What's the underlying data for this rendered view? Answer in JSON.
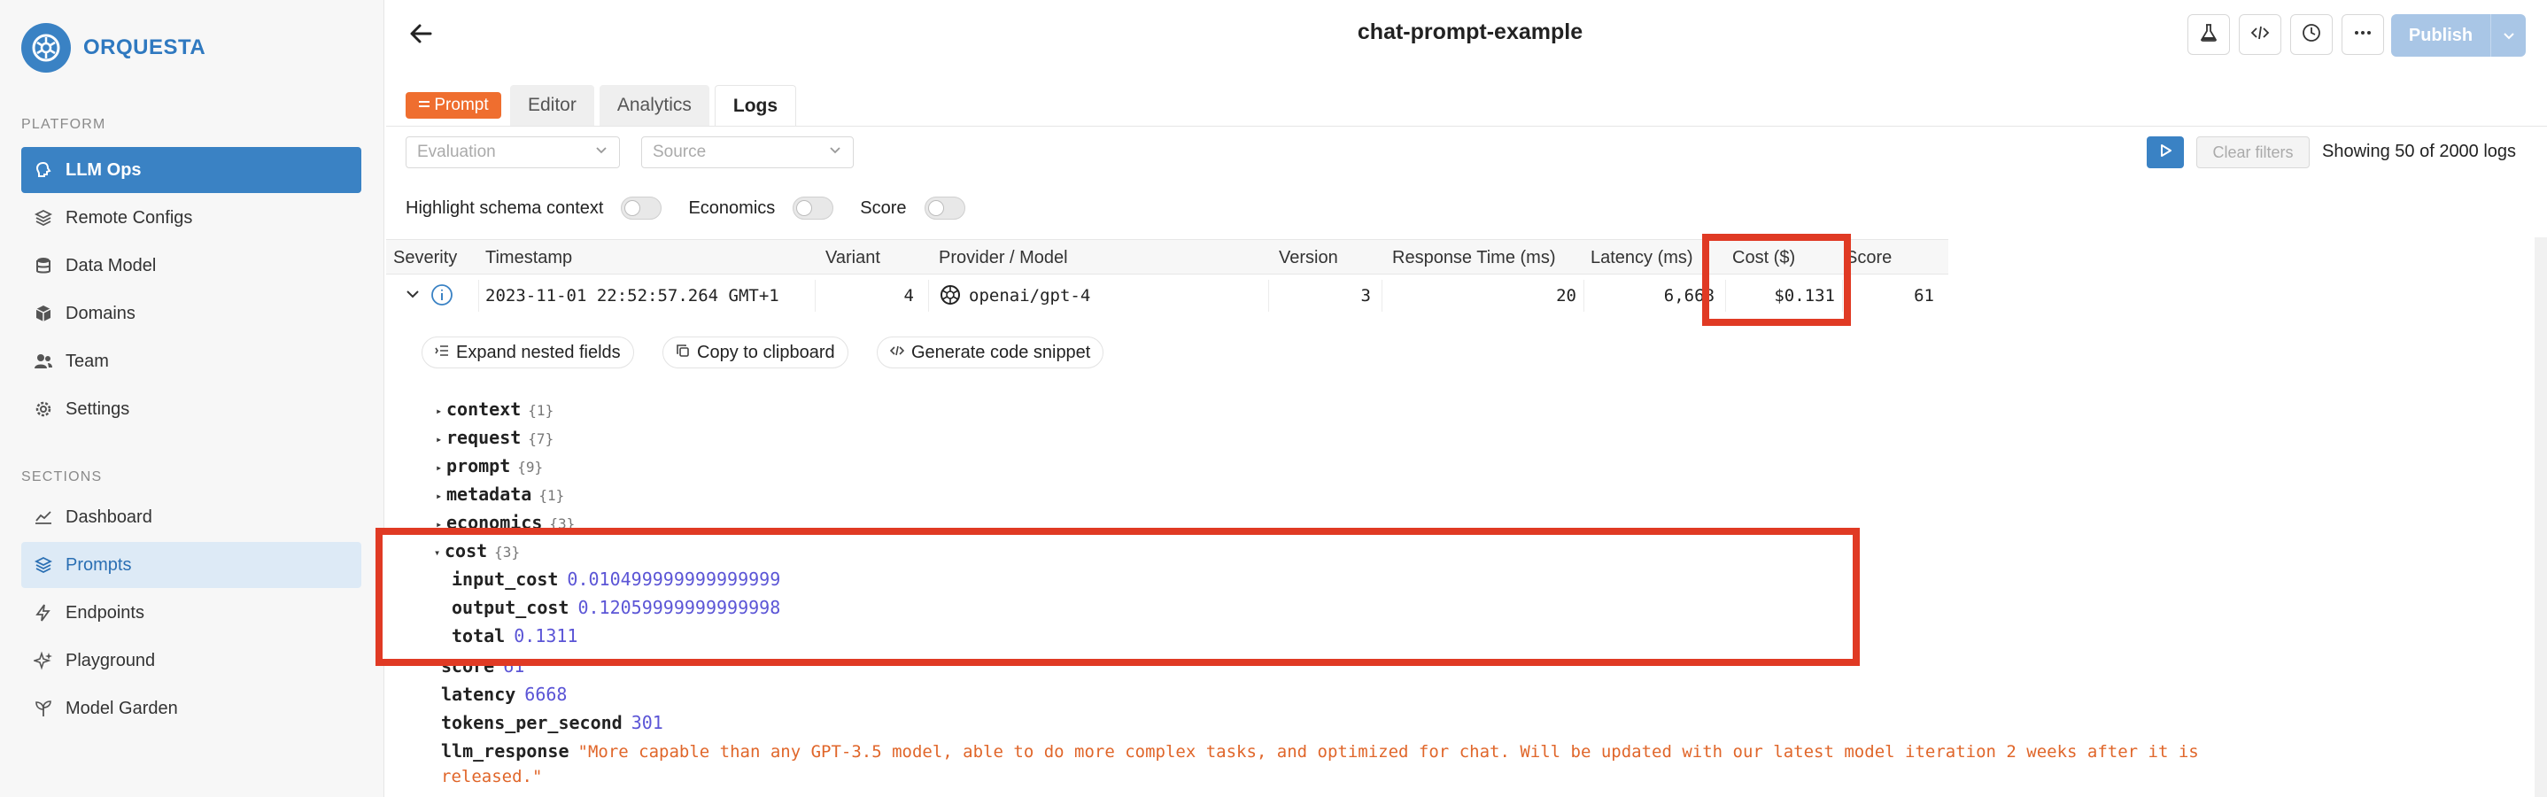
{
  "brand": {
    "name": "ORQUESTA"
  },
  "sidebar": {
    "platform_label": "PLATFORM",
    "platform_items": [
      {
        "label": "LLM Ops",
        "icon": "brain-icon"
      },
      {
        "label": "Remote Configs",
        "icon": "layers-icon"
      },
      {
        "label": "Data Model",
        "icon": "database-icon"
      },
      {
        "label": "Domains",
        "icon": "cube-icon"
      },
      {
        "label": "Team",
        "icon": "users-icon"
      },
      {
        "label": "Settings",
        "icon": "gear-icon"
      }
    ],
    "sections_label": "SECTIONS",
    "section_items": [
      {
        "label": "Dashboard",
        "icon": "chart-line-icon"
      },
      {
        "label": "Prompts",
        "icon": "layers-icon"
      },
      {
        "label": "Endpoints",
        "icon": "bolt-icon"
      },
      {
        "label": "Playground",
        "icon": "sparkle-icon"
      },
      {
        "label": "Model Garden",
        "icon": "plant-icon"
      }
    ]
  },
  "header": {
    "title": "chat-prompt-example",
    "publish_label": "Publish"
  },
  "tabs": {
    "badge": "Prompt",
    "items": [
      "Editor",
      "Analytics",
      "Logs"
    ]
  },
  "filters": {
    "evaluation_placeholder": "Evaluation",
    "source_placeholder": "Source",
    "clear_label": "Clear filters",
    "showing_text": "Showing 50 of 2000 logs"
  },
  "toggles": [
    {
      "label": "Highlight schema context",
      "on": false
    },
    {
      "label": "Economics",
      "on": false
    },
    {
      "label": "Score",
      "on": false
    }
  ],
  "table": {
    "columns": [
      "Severity",
      "Timestamp",
      "Variant",
      "Provider / Model",
      "Version",
      "Response Time (ms)",
      "Latency (ms)",
      "Cost ($)",
      "Score"
    ],
    "row": {
      "timestamp": "2023-11-01 22:52:57.264 GMT+1",
      "variant": "4",
      "model": "openai/gpt-4",
      "version": "3",
      "response_time": "20",
      "latency": "6,668",
      "cost": "$0.131",
      "score": "61"
    }
  },
  "actions": {
    "expand": "Expand nested fields",
    "copy": "Copy to clipboard",
    "snippet": "Generate code snippet"
  },
  "tree": {
    "context": {
      "key": "context",
      "count": "{1}"
    },
    "request": {
      "key": "request",
      "count": "{7}"
    },
    "prompt": {
      "key": "prompt",
      "count": "{9}"
    },
    "metadata": {
      "key": "metadata",
      "count": "{1}"
    },
    "economics": {
      "key": "economics",
      "count": "{3}"
    },
    "cost": {
      "key": "cost",
      "count": "{3}"
    },
    "input_cost": {
      "key": "input_cost",
      "value": "0.010499999999999999"
    },
    "output_cost": {
      "key": "output_cost",
      "value": "0.12059999999999998"
    },
    "total": {
      "key": "total",
      "value": "0.1311"
    },
    "score": {
      "key": "score",
      "value": "61"
    },
    "latency": {
      "key": "latency",
      "value": "6668"
    },
    "tokens_per_second": {
      "key": "tokens_per_second",
      "value": "301"
    },
    "llm_response": {
      "key": "llm_response",
      "line1": "\"More capable than any GPT-3.5 model, able to do more complex tasks, and optimized for chat. Will be updated with our latest model iteration 2 weeks after it is",
      "line2": "released.\""
    }
  },
  "colors": {
    "accent": "#3a82c4",
    "badge": "#ef6e2f",
    "highlight": "#e03a24",
    "number": "#5b55d6",
    "string": "#e0662a"
  }
}
